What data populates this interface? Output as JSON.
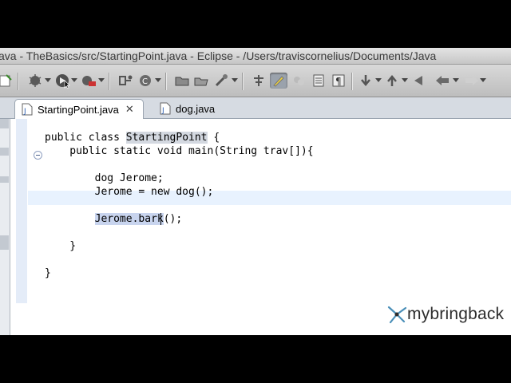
{
  "window": {
    "title": "ava - TheBasics/src/StartingPoint.java - Eclipse - /Users/traviscornelius/Documents/Java"
  },
  "toolbar": {
    "icons": [
      "new-icon",
      "save-icon",
      "debug-icon",
      "run-icon",
      "external-tools-icon",
      "new-class-icon",
      "new-package-icon",
      "open-folder-icon",
      "open-type-icon",
      "search-icon",
      "annotation-icon",
      "highlight-icon",
      "mark-icon",
      "task-icon",
      "show-whitespace-icon",
      "next-annotation-icon",
      "prev-annotation-icon",
      "back-icon",
      "forward-icon"
    ]
  },
  "tabs": [
    {
      "label": "StartingPoint.java",
      "active": true
    },
    {
      "label": "dog.java",
      "active": false
    }
  ],
  "code": {
    "lines": [
      {
        "text": "public class StartingPoint {"
      },
      {
        "text": "    public static void main(String trav[]){"
      },
      {
        "text": ""
      },
      {
        "text": "        dog Jerome;"
      },
      {
        "text": "        Jerome = new dog();"
      },
      {
        "text": ""
      },
      {
        "text": "        Jerome.bark();"
      },
      {
        "text": ""
      },
      {
        "text": "    }"
      },
      {
        "text": ""
      },
      {
        "text": "}"
      }
    ],
    "class_name": "StartingPoint",
    "selected_text": "Jerome.bark"
  },
  "watermark": {
    "text": "mybringback"
  }
}
